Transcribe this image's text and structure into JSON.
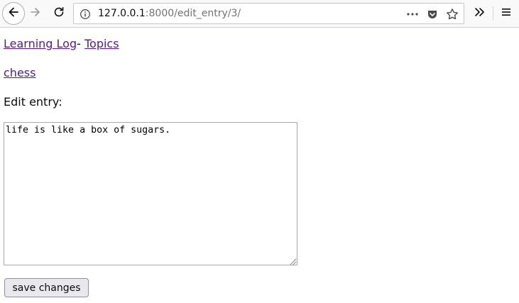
{
  "browser": {
    "url_host": "127.0.0.1",
    "url_rest": ":8000/edit_entry/3/",
    "icons": {
      "back": "back-arrow-icon",
      "forward": "forward-arrow-icon",
      "reload": "reload-icon",
      "info": "info-icon",
      "more": "more-dots-icon",
      "pocket": "pocket-icon",
      "bookmark": "star-icon",
      "overflow": "chevron-double-right-icon",
      "menu": "hamburger-menu-icon"
    }
  },
  "page": {
    "nav": {
      "home_link": "Learning Log",
      "separator": "- ",
      "topics_link": "Topics"
    },
    "topic_link": "chess",
    "heading": "Edit entry:",
    "entry_text": "life is like a box of sugars.",
    "save_button": "save changes"
  },
  "colors": {
    "visited_link": "#551a8b",
    "toolbar_bg": "#f9f9fa"
  }
}
